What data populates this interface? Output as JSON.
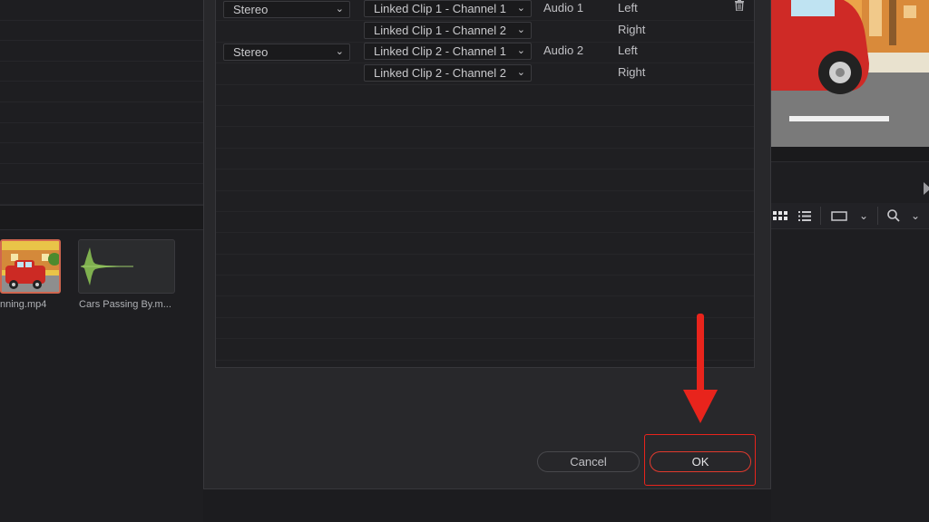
{
  "media_pool": {
    "clips": [
      {
        "name": "nning.mp4",
        "selected": true
      },
      {
        "name": "Cars Passing By.m...",
        "selected": false
      }
    ]
  },
  "dialog": {
    "rows": [
      {
        "format": "Stereo",
        "source": "Linked Clip 1 - Channel 1",
        "track": "Audio 1",
        "channel": "Left"
      },
      {
        "format": "",
        "source": "Linked Clip 1 - Channel 2",
        "track": "",
        "channel": "Right"
      },
      {
        "format": "Stereo",
        "source": "Linked Clip 2 - Channel 1",
        "track": "Audio 2",
        "channel": "Left"
      },
      {
        "format": "",
        "source": "Linked Clip 2 - Channel 2",
        "track": "",
        "channel": "Right"
      }
    ],
    "cancel_label": "Cancel",
    "ok_label": "OK"
  },
  "annotation": {
    "color": "#e8241c",
    "arrow": "down-arrow",
    "highlight_target": "ok-button"
  },
  "toolbar_icons": [
    "grid-view-icon",
    "list-view-icon",
    "monitor-icon",
    "chevron-down-icon",
    "search-icon",
    "chevron-down-icon"
  ]
}
